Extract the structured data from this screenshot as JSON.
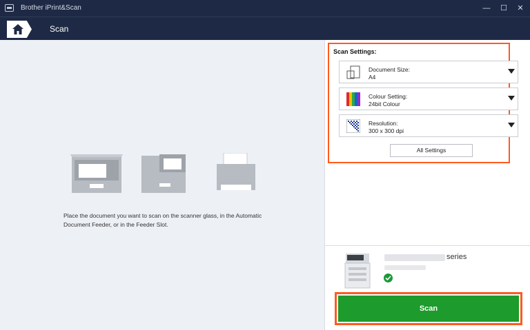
{
  "window": {
    "title": "Brother iPrint&Scan",
    "controls": {
      "minimize": "—",
      "maximize": "☐",
      "close": "✕"
    }
  },
  "nav": {
    "title": "Scan",
    "home_icon": "home-icon"
  },
  "left": {
    "instruction": "Place the document you want to scan on the scanner glass, in the Automatic Document Feeder, or in the Feeder Slot.",
    "devices": [
      "flatbed-scanner-icon",
      "adf-scanner-icon",
      "feeder-slot-icon"
    ]
  },
  "settings": {
    "heading": "Scan Settings:",
    "document_size": {
      "label": "Document Size:",
      "value": "A4",
      "icon": "document-size-icon"
    },
    "colour_setting": {
      "label": "Colour Setting:",
      "value": "24bit Colour",
      "icon": "colour-bars-icon"
    },
    "resolution": {
      "label": "Resolution:",
      "value": "300 x 300 dpi",
      "icon": "resolution-grid-icon"
    },
    "all_settings_label": "All Settings"
  },
  "device": {
    "model_suffix": "series",
    "status_icon": "check-circle-icon"
  },
  "scan_button_label": "Scan",
  "colors": {
    "accent_highlight": "#ff5a1f",
    "scan_green": "#1d9b2c",
    "titlebar": "#1e2a45"
  }
}
